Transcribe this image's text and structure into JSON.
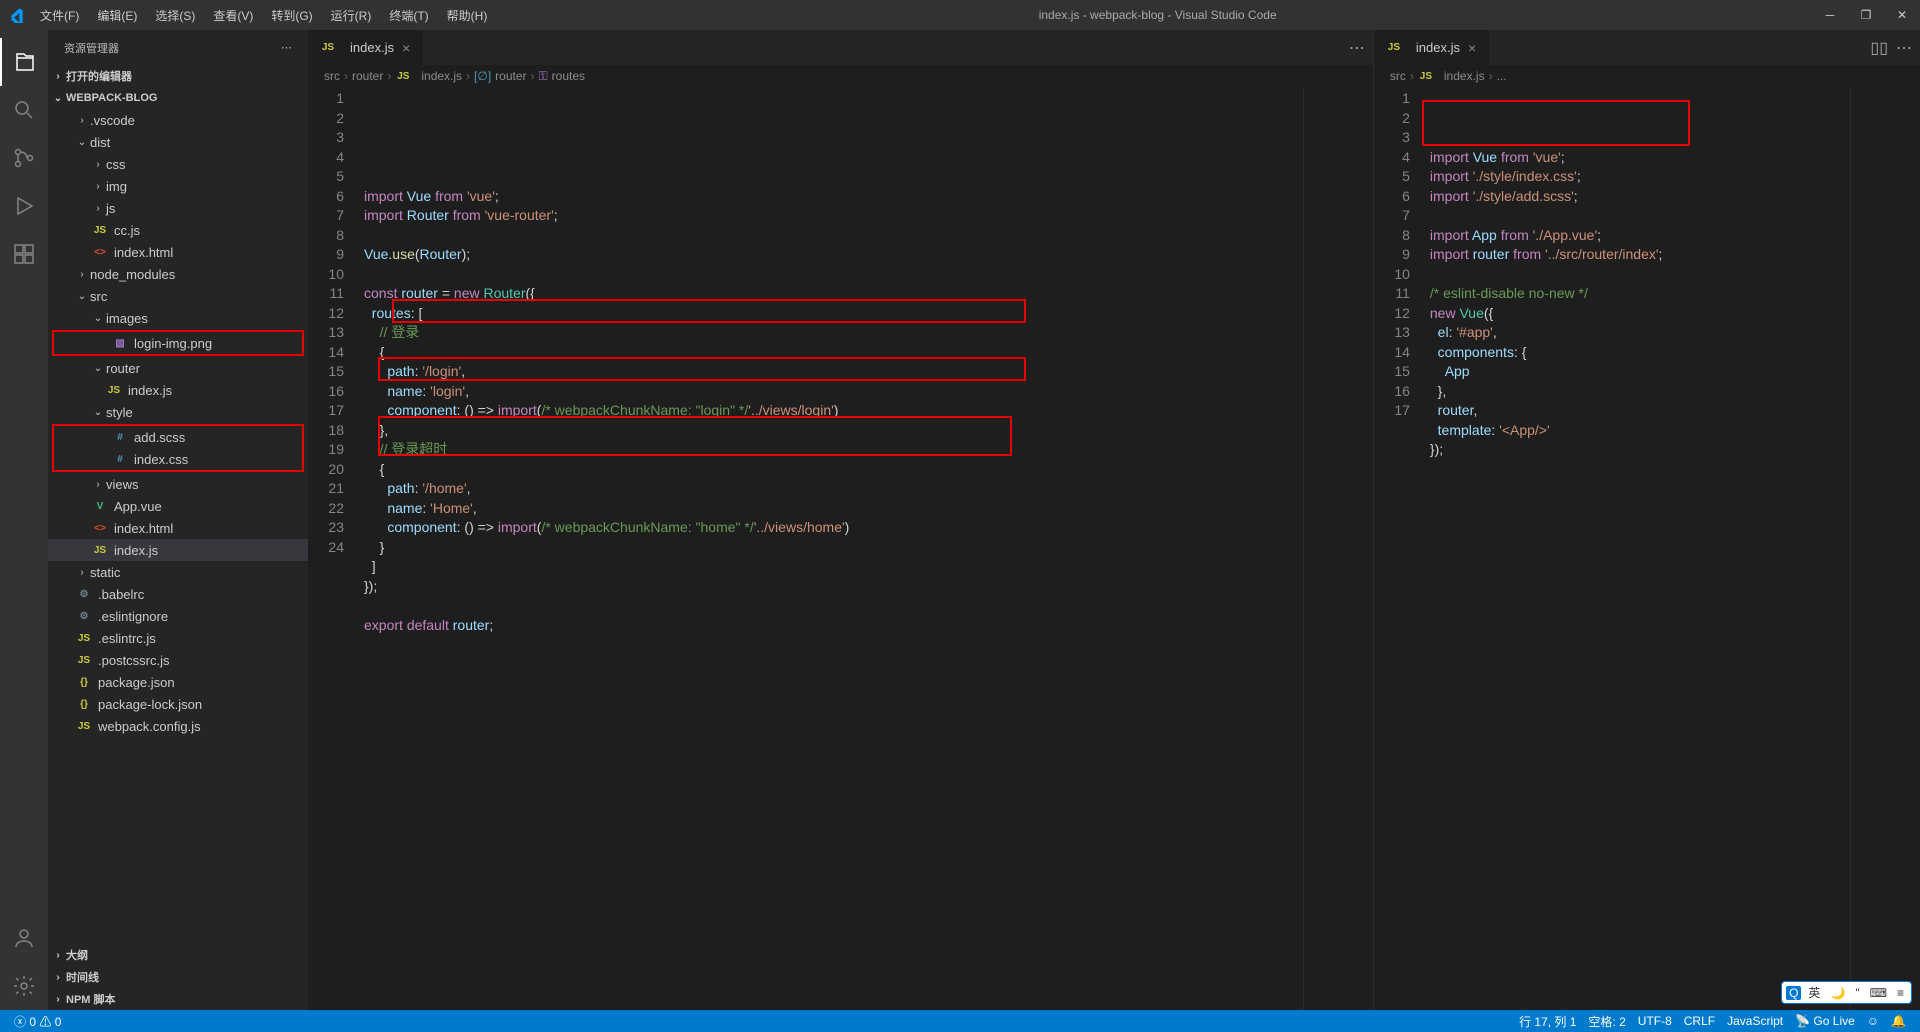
{
  "title": "index.js - webpack-blog - Visual Studio Code",
  "menu": [
    "文件(F)",
    "编辑(E)",
    "选择(S)",
    "查看(V)",
    "转到(G)",
    "运行(R)",
    "终端(T)",
    "帮助(H)"
  ],
  "sidebar": {
    "header": "资源管理器",
    "openEditors": "打开的编辑器",
    "project": "WEBPACK-BLOG",
    "tree": [
      {
        "d": 1,
        "t": "folder",
        "open": false,
        "label": ".vscode"
      },
      {
        "d": 1,
        "t": "folder",
        "open": true,
        "label": "dist"
      },
      {
        "d": 2,
        "t": "folder",
        "open": false,
        "label": "css"
      },
      {
        "d": 2,
        "t": "folder",
        "open": false,
        "label": "img"
      },
      {
        "d": 2,
        "t": "folder",
        "open": false,
        "label": "js"
      },
      {
        "d": 2,
        "t": "file",
        "icon": "js",
        "label": "cc.js"
      },
      {
        "d": 2,
        "t": "file",
        "icon": "html",
        "label": "index.html"
      },
      {
        "d": 1,
        "t": "folder",
        "open": false,
        "label": "node_modules"
      },
      {
        "d": 1,
        "t": "folder",
        "open": true,
        "label": "src"
      },
      {
        "d": 2,
        "t": "folder",
        "open": true,
        "label": "images"
      },
      {
        "d": 3,
        "t": "file",
        "icon": "img",
        "label": "login-img.png",
        "box": true
      },
      {
        "d": 2,
        "t": "folder",
        "open": true,
        "label": "router"
      },
      {
        "d": 3,
        "t": "file",
        "icon": "js",
        "label": "index.js"
      },
      {
        "d": 2,
        "t": "folder",
        "open": true,
        "label": "style"
      },
      {
        "d": 3,
        "t": "file",
        "icon": "css",
        "label": "add.scss",
        "box": "start"
      },
      {
        "d": 3,
        "t": "file",
        "icon": "css",
        "label": "index.css",
        "box": "end"
      },
      {
        "d": 2,
        "t": "folder",
        "open": false,
        "label": "views"
      },
      {
        "d": 2,
        "t": "file",
        "icon": "vue",
        "label": "App.vue"
      },
      {
        "d": 2,
        "t": "file",
        "icon": "html",
        "label": "index.html"
      },
      {
        "d": 2,
        "t": "file",
        "icon": "js",
        "label": "index.js",
        "selected": true
      },
      {
        "d": 1,
        "t": "folder",
        "open": false,
        "label": "static"
      },
      {
        "d": 1,
        "t": "file",
        "icon": "cfg",
        "label": ".babelrc"
      },
      {
        "d": 1,
        "t": "file",
        "icon": "cfg",
        "label": ".eslintignore"
      },
      {
        "d": 1,
        "t": "file",
        "icon": "js",
        "label": ".eslintrc.js"
      },
      {
        "d": 1,
        "t": "file",
        "icon": "js",
        "label": ".postcssrc.js"
      },
      {
        "d": 1,
        "t": "file",
        "icon": "json",
        "label": "package.json"
      },
      {
        "d": 1,
        "t": "file",
        "icon": "json",
        "label": "package-lock.json"
      },
      {
        "d": 1,
        "t": "file",
        "icon": "js",
        "label": "webpack.config.js"
      }
    ],
    "outline": "大纲",
    "timeline": "时间线",
    "npm": "NPM 脚本"
  },
  "left": {
    "tab": "index.js",
    "crumbs": [
      "src",
      "router",
      "index.js",
      "router",
      "routes"
    ],
    "lines": 24
  },
  "right": {
    "tab": "index.js",
    "crumbs": [
      "src",
      "index.js",
      "..."
    ],
    "lines": 17
  },
  "status": {
    "errors": "0",
    "warnings": "0",
    "pos": "行 17, 列 1",
    "spaces": "空格: 2",
    "enc": "UTF-8",
    "eol": "CRLF",
    "lang": "JavaScript",
    "golive": "Go Live"
  },
  "ime": [
    "英"
  ]
}
